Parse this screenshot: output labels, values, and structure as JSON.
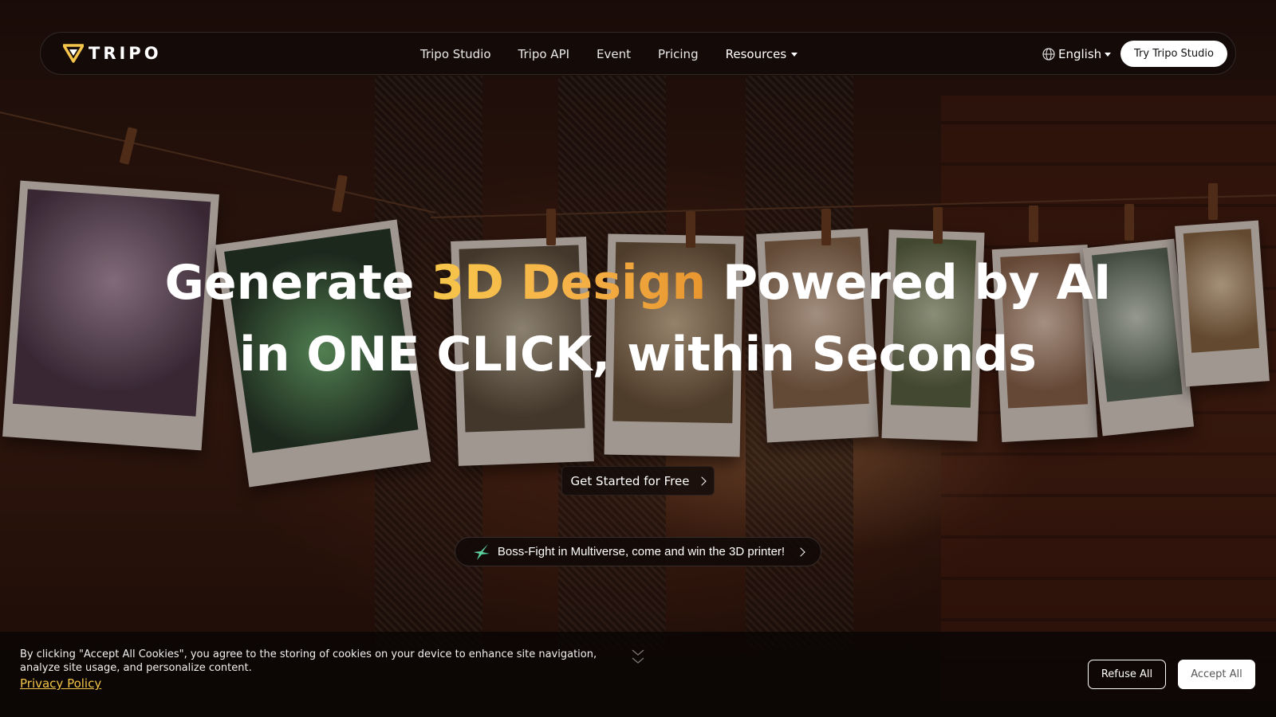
{
  "nav": {
    "logo_text": "TRIPO",
    "links": [
      {
        "label": "Tripo Studio"
      },
      {
        "label": "Tripo API"
      },
      {
        "label": "Event"
      },
      {
        "label": "Pricing"
      },
      {
        "label": "Resources",
        "icon": "caret-down-icon"
      }
    ],
    "language": {
      "label": "English",
      "icon": "globe-icon"
    },
    "cta_label": "Try Tripo Studio"
  },
  "hero": {
    "line1_pre": "Generate ",
    "line1_highlight": "3D Design",
    "line1_post": " Powered by AI",
    "line2": "in ONE CLICK, within Seconds",
    "highlight_colors": [
      "#f6c64a",
      "#e8962f"
    ]
  },
  "cta": {
    "label": "Get Started for Free",
    "icon": "chevron-right-icon"
  },
  "promo": {
    "label": "Boss-Fight in Multiverse, come and win the 3D printer!",
    "icon": "sparkle-icon"
  },
  "cookie": {
    "text": "By clicking \"Accept All Cookies\", you agree to the storing of cookies on your device to enhance site navigation, analyze site usage, and personalize content.",
    "privacy_label": "Privacy Policy",
    "refuse_label": "Refuse All",
    "accept_label": "Accept All",
    "link_color": "#f3c54b"
  }
}
